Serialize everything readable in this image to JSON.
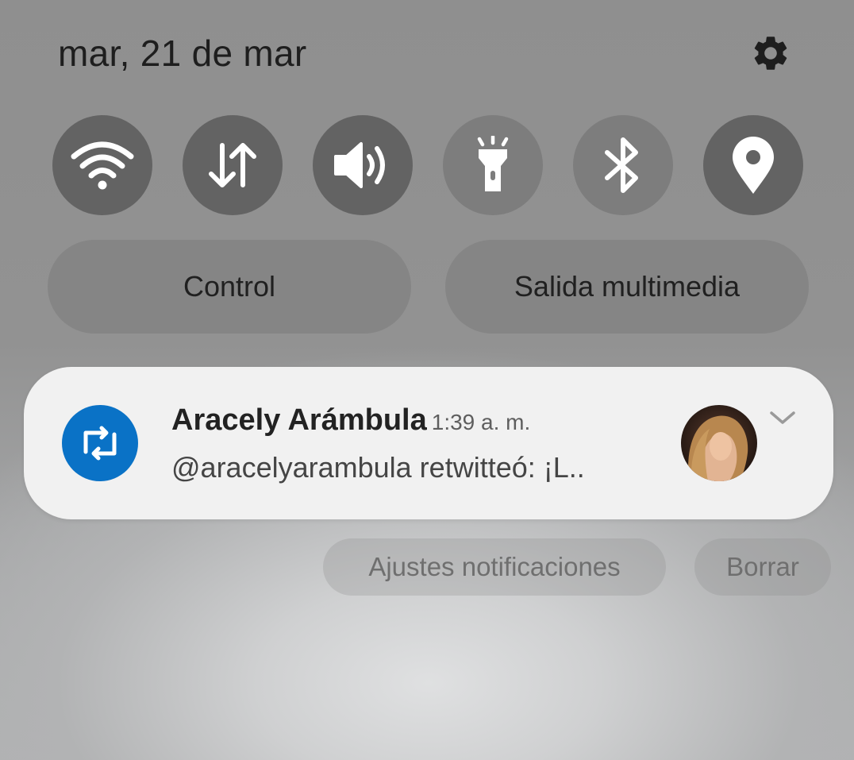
{
  "header": {
    "date": "mar, 21 de mar",
    "settings_icon": "gear-icon"
  },
  "quick_settings": [
    {
      "name": "wifi",
      "icon": "wifi-icon",
      "state": "on"
    },
    {
      "name": "mobile-data",
      "icon": "data-arrows-icon",
      "state": "on"
    },
    {
      "name": "sound",
      "icon": "volume-icon",
      "state": "on"
    },
    {
      "name": "flashlight",
      "icon": "flashlight-icon",
      "state": "off"
    },
    {
      "name": "bluetooth",
      "icon": "bluetooth-icon",
      "state": "off"
    },
    {
      "name": "location",
      "icon": "location-pin-icon",
      "state": "on"
    }
  ],
  "pills": {
    "control": "Control",
    "media_output": "Salida multimedia"
  },
  "notification": {
    "app_icon": "retweet-icon",
    "app_color": "#0a72c6",
    "title": "Aracely Arámbula",
    "time": "1:39 a. m.",
    "text": "@aracelyarambula retwitteó: ¡L..",
    "avatar": "avatar-photo",
    "expand_icon": "chevron-down-icon"
  },
  "actions": {
    "notification_settings": "Ajustes notificaciones",
    "clear": "Borrar"
  },
  "colors": {
    "tile_on": "#636363",
    "tile_off": "#7d7d7d",
    "pill_bg": "#858585",
    "card_bg": "#f1f1f1"
  }
}
